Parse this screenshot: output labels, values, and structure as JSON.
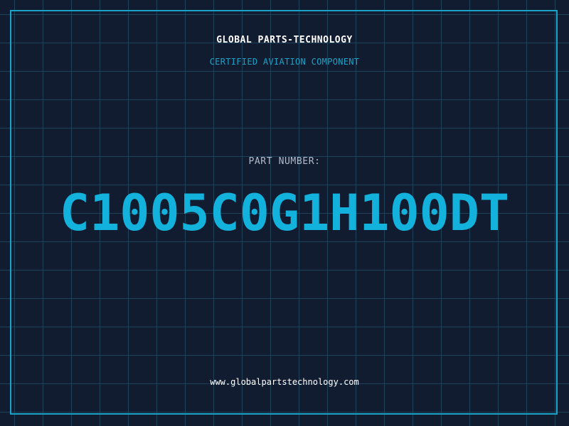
{
  "header": {
    "company": "GLOBAL PARTS-TECHNOLOGY",
    "tagline": "CERTIFIED AVIATION COMPONENT"
  },
  "part": {
    "label": "PART NUMBER:",
    "number": "C1005C0G1H100DT"
  },
  "footer": {
    "website": "www.globalpartstechnology.com"
  },
  "colors": {
    "background": "#121c31",
    "grid": "#1f4159",
    "accent": "#1aa3c6",
    "part_number": "#12b2dc",
    "label": "#b3bccb",
    "text": "#ffffff"
  }
}
